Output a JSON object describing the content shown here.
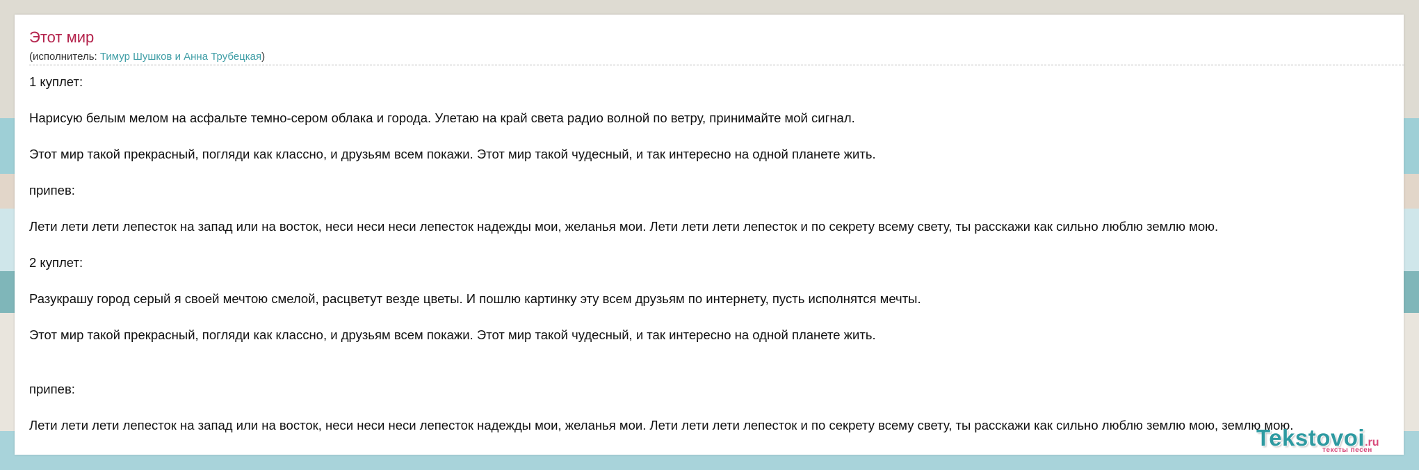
{
  "song": {
    "title": "Этот мир",
    "performer_prefix": "(исполнитель: ",
    "performer_name": "Тимур Шушков и Анна Трубецкая",
    "performer_suffix": ")"
  },
  "lyrics": [
    "1 куплет:",
    "Нарисую белым мелом на асфальте темно-сером облака и города. Улетаю на край света радио волной по ветру, принимайте мой сигнал.",
    "Этот мир такой прекрасный, погляди как классно, и друзьям всем покажи. Этот мир такой чудесный, и так интересно на одной планете жить.",
    "припев:",
    "Лети лети лети лепесток на запад или на восток, неси неси неси лепесток надежды мои, желанья мои. Лети лети лети лепесток и по секрету всему свету, ты расскажи как сильно люблю землю мою.",
    "2 куплет:",
    "Разукрашу город серый я своей мечтою смелой, расцветут везде цветы. И пошлю картинку эту всем друзьям по интернету, пусть исполнятся мечты.",
    "Этот мир такой прекрасный, погляди как классно, и друзьям всем покажи. Этот мир такой чудесный, и так интересно на одной планете жить.",
    "припев:",
    "Лети лети лети лепесток на запад или на восток, неси неси неси лепесток надежды мои, желанья мои. Лети лети лети лепесток и по секрету всему свету, ты расскажи как сильно люблю землю мою, землю мою."
  ],
  "logo": {
    "name": "Tekstovoi",
    "tld": ".ru",
    "tagline": "тексты песен"
  },
  "colors": {
    "title": "#b4234c",
    "link": "#3f9ea6",
    "logo_main": "#2e9aa1",
    "logo_accent": "#d8497a"
  }
}
